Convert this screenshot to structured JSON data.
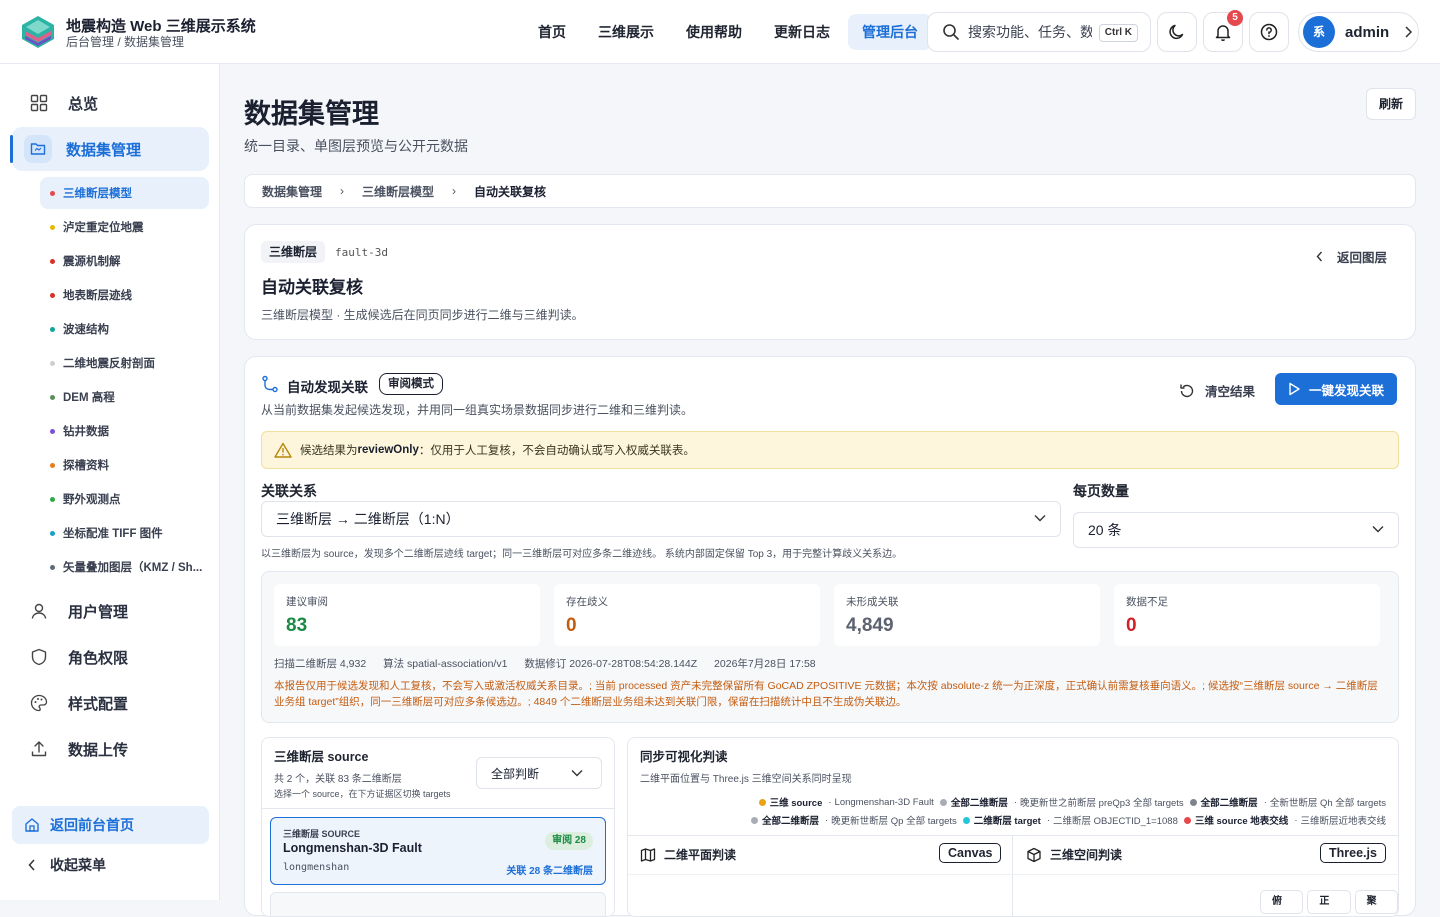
{
  "header": {
    "title": "地震构造 Web 三维展示系统",
    "breadcrumb": "后台管理 / 数据集管理",
    "nav": [
      "首页",
      "三维展示",
      "使用帮助",
      "更新日志",
      "管理后台"
    ],
    "search_placeholder": "搜索功能、任务、数据集",
    "search_shortcut": "Ctrl K",
    "notification_count": "5",
    "user_avatar": "系",
    "user_name": "admin"
  },
  "sidebar": {
    "overview": "总览",
    "dataset_mgmt": "数据集管理",
    "sub_items": [
      {
        "label": "三维断层模型",
        "color": "#e5484d"
      },
      {
        "label": "泸定重定位地震",
        "color": "#e6b800"
      },
      {
        "label": "震源机制解",
        "color": "#d93025"
      },
      {
        "label": "地表断层迹线",
        "color": "#d93025"
      },
      {
        "label": "波速结构",
        "color": "#12a39a"
      },
      {
        "label": "二维地震反射剖面",
        "color": "#cfcfcf"
      },
      {
        "label": "DEM 高程",
        "color": "#5a8f5a"
      },
      {
        "label": "钻井数据",
        "color": "#7b4fd6"
      },
      {
        "label": "探槽资料",
        "color": "#ea7a1c"
      },
      {
        "label": "野外观测点",
        "color": "#2ea84a"
      },
      {
        "label": "坐标配准 TIFF 图件",
        "color": "#17a2c8"
      },
      {
        "label": "矢量叠加图层（KMZ / Sh...",
        "color": "#5b6b7a"
      }
    ],
    "user_mgmt": "用户管理",
    "role_perm": "角色权限",
    "style_config": "样式配置",
    "data_upload": "数据上传",
    "back_home": "返回前台首页",
    "collapse": "收起菜单"
  },
  "page": {
    "title": "数据集管理",
    "subtitle": "统一目录、单图层预览与公开元数据",
    "refresh": "刷新",
    "breadcrumbs": [
      "数据集管理",
      "三维断层模型",
      "自动关联复核"
    ]
  },
  "layer_card": {
    "tag": "三维断层",
    "code": "fault-3d",
    "back_label": "返回图层",
    "title": "自动关联复核",
    "desc": "三维断层模型 · 生成候选后在同页同步进行二维与三维判读。"
  },
  "discover": {
    "title": "自动发现关联",
    "mode": "审阅模式",
    "desc": "从当前数据集发起候选发现，并用同一组真实场景数据同步进行二维和三维判读。",
    "clear_label": "清空结果",
    "run_label": "一键发现关联",
    "warning_prefix": "候选结果为 ",
    "warning_key": "reviewOnly",
    "warning_suffix": "：仅用于人工复核，不会自动确认或写入权威关联表。",
    "relation_label": "关联关系",
    "relation_value": "三维断层 → 二维断层（1:N）",
    "page_size_label": "每页数量",
    "page_size_value": "20 条",
    "relation_hint": "以三维断层为 source，发现多个二维断层迹线 target；同一三维断层可对应多条二维迹线。 系统内部固定保留 Top 3，用于完整计算歧义关系边。",
    "stats": [
      {
        "label": "建议审阅",
        "value": "83",
        "color": "#1a8a43"
      },
      {
        "label": "存在歧义",
        "value": "0",
        "color": "#c45c10"
      },
      {
        "label": "未形成关联",
        "value": "4,849",
        "color": "#5b6270"
      },
      {
        "label": "数据不足",
        "value": "0",
        "color": "#d0202a"
      }
    ],
    "meta": [
      "扫描二维断层 4,932",
      "算法 spatial-association/v1",
      "数据修订 2026-07-28T08:54:28.144Z",
      "2026年7月28日 17:58"
    ],
    "note": "本报告仅用于候选发现和人工复核，不会写入或激活权威关系目录。; 当前 processed 资产未完整保留所有 GoCAD ZPOSITIVE 元数据；本次按 absolute-z 统一为正深度，正式确认前需复核垂向语义。; 候选按“三维断层 source → 二维断层业务组 target”组织，同一三维断层可对应多条候选边。; 4849 个二维断层业务组未达到关联门限，保留在扫描统计中且不生成伪关联边。"
  },
  "source_panel": {
    "title": "三维断层 source",
    "summary": "共 2 个，关联 83 条二维断层",
    "hint": "选择一个 source，在下方证据区切换 targets",
    "filter": "全部判断",
    "item_kicker": "三维断层 SOURCE",
    "item_name": "Longmenshan-3D Fault",
    "item_code": "longmenshan",
    "item_badge": "审阅 28",
    "item_link": "关联 28 条二维断层"
  },
  "viz_panel": {
    "title": "同步可视化判读",
    "desc": "二维平面位置与 Three.js 三维空间关系同时呈现",
    "legend1": [
      {
        "key": "三维 source",
        "text": "Longmenshan-3D Fault",
        "color": "#e8a317"
      },
      {
        "key": "全部二维断层",
        "text": "晚更新世之前断层 preQp3 全部 targets",
        "color": "#a8adb5"
      },
      {
        "key": "全部二维断层",
        "text": "全新世断层 Qh 全部 targets",
        "color": "#7e848e"
      }
    ],
    "legend2": [
      {
        "key": "全部二维断层",
        "text": "晚更新世断层 Qp 全部 targets",
        "color": "#a8adb5"
      },
      {
        "key": "二维断层 target",
        "text": "二维断层 OBJECTID_1=1088",
        "color": "#22c7d8"
      },
      {
        "key": "三维 source 地表交线",
        "text": "三维断层近地表交线",
        "color": "#e5484d"
      }
    ],
    "plan_title": "二维平面判读",
    "plan_engine": "Canvas",
    "space_title": "三维空间判读",
    "space_engine": "Three.js",
    "view_buttons": [
      "俯视",
      "正视",
      "聚焦"
    ]
  }
}
